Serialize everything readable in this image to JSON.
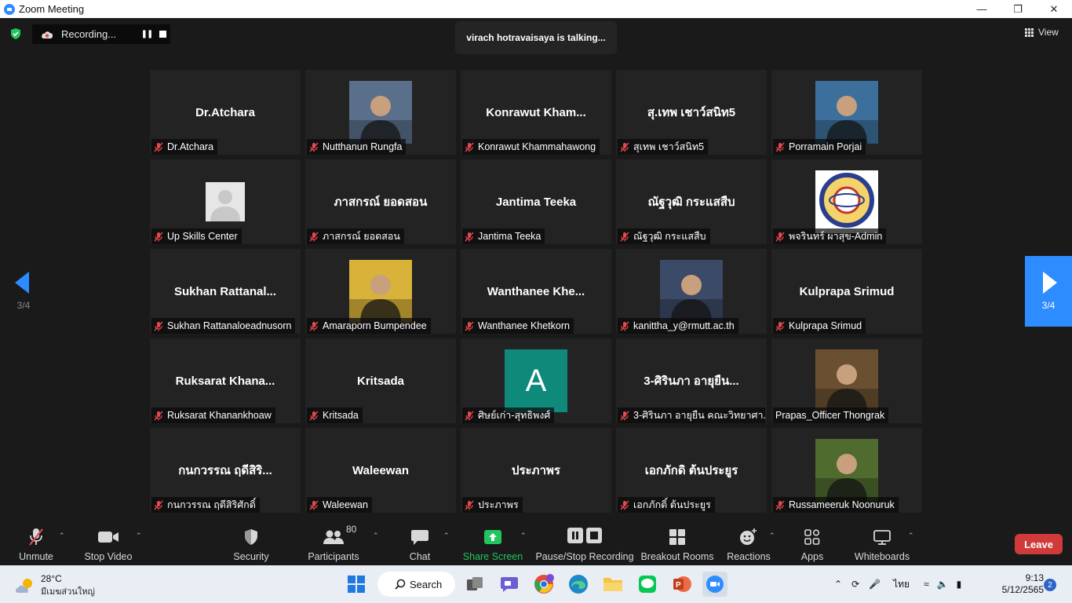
{
  "window": {
    "title": "Zoom Meeting"
  },
  "top_bar": {
    "recording_label": "Recording...",
    "talking_text": "virach hotravaisaya is talking...",
    "view_label": "View"
  },
  "pagination": {
    "left_page": "3/4",
    "right_page": "3/4"
  },
  "participants": [
    {
      "display": "name",
      "big_name": "Dr.Atchara",
      "label": "Dr.Atchara",
      "muted": true
    },
    {
      "display": "photo",
      "big_name": "",
      "label": "Nutthanun Rungfa",
      "muted": true,
      "photo_color": "#5a6f8a"
    },
    {
      "display": "name",
      "big_name": "Konrawut  Kham...",
      "label": "Konrawut Khammahawong",
      "muted": true
    },
    {
      "display": "name",
      "big_name": "สุ.เทพ เชาว์สนิท5",
      "label": "สุเทพ เชาว์สนิท5",
      "muted": true
    },
    {
      "display": "photo",
      "big_name": "",
      "label": "Porramain Porjai",
      "muted": true,
      "photo_color": "#3c6f9c"
    },
    {
      "display": "avatar",
      "big_name": "",
      "label": "Up Skills Center",
      "muted": true
    },
    {
      "display": "name",
      "big_name": "ภาสกรณ์ ยอดสอน",
      "label": "ภาสกรณ์ ยอดสอน",
      "muted": true
    },
    {
      "display": "name",
      "big_name": "Jantima Teeka",
      "label": "Jantima Teeka",
      "muted": true
    },
    {
      "display": "name",
      "big_name": "ณัฐวุฒิ กระแสสืบ",
      "label": "ณัฐวุฒิ กระแสสืบ",
      "muted": true
    },
    {
      "display": "logo",
      "big_name": "",
      "label": "พจรินทร์ ผาสุข-Admin",
      "muted": true
    },
    {
      "display": "name",
      "big_name": "Sukhan  Rattanal...",
      "label": "Sukhan Rattanaloeadnusorn",
      "muted": true
    },
    {
      "display": "photo",
      "big_name": "",
      "label": "Amaraporn Bumpendee",
      "muted": true,
      "photo_color": "#d9b23a"
    },
    {
      "display": "name",
      "big_name": "Wanthanee  Khe...",
      "label": "Wanthanee Khetkorn",
      "muted": true
    },
    {
      "display": "photo",
      "big_name": "",
      "label": "kanittha_y@rmutt.ac.th",
      "muted": true,
      "photo_color": "#3b4a66"
    },
    {
      "display": "name",
      "big_name": "Kulprapa Srimud",
      "label": "Kulprapa Srimud",
      "muted": true
    },
    {
      "display": "name",
      "big_name": "Ruksarat  Khana...",
      "label": "Ruksarat Khanankhoaw",
      "muted": true
    },
    {
      "display": "name",
      "big_name": "Kritsada",
      "label": "Kritsada",
      "muted": true
    },
    {
      "display": "letter",
      "big_name": "A",
      "label": "ศิษย์เก่า-สุทธิพงศ์",
      "muted": true
    },
    {
      "display": "name",
      "big_name": "3-ศิรินภา อายุยืน...",
      "label": "3-ศิรินภา อายุยืน คณะวิทยาศา...",
      "muted": true
    },
    {
      "display": "photo",
      "big_name": "",
      "label": "Prapas_Officer Thongrak",
      "muted": false,
      "photo_color": "#6a5030"
    },
    {
      "display": "name",
      "big_name": "กนกวรรณ ฤดีสิริ...",
      "label": "กนกวรรณ ฤดีสิริศักดิ์",
      "muted": true
    },
    {
      "display": "name",
      "big_name": "Waleewan",
      "label": "Waleewan",
      "muted": true
    },
    {
      "display": "name",
      "big_name": "ประภาพร",
      "label": "ประภาพร",
      "muted": true
    },
    {
      "display": "name",
      "big_name": "เอกภักดิ ต้นประยูร",
      "label": "เอกภักดิ์ ต้นประยูร",
      "muted": true
    },
    {
      "display": "photo",
      "big_name": "",
      "label": "Russameeruk Noonuruk",
      "muted": true,
      "photo_color": "#4f6b2e"
    }
  ],
  "toolbar": {
    "unmute": "Unmute",
    "stop_video": "Stop Video",
    "security": "Security",
    "participants": "Participants",
    "participants_count": "80",
    "chat": "Chat",
    "share_screen": "Share Screen",
    "pause_stop_recording": "Pause/Stop Recording",
    "breakout_rooms": "Breakout Rooms",
    "reactions": "Reactions",
    "apps": "Apps",
    "whiteboards": "Whiteboards",
    "leave": "Leave"
  },
  "taskbar": {
    "temperature": "28°C",
    "location": "มีเมฆส่วนใหญ่",
    "search_label": "Search",
    "language": "ไทย",
    "time": "9:13",
    "date": "5/12/2565",
    "notification_count": "2"
  },
  "colors": {
    "accent": "#2d8cff",
    "leave": "#d13a3a",
    "share_green": "#22c55e",
    "muted_red": "#e5484d",
    "letter_avatar": "#0f8a7a"
  }
}
